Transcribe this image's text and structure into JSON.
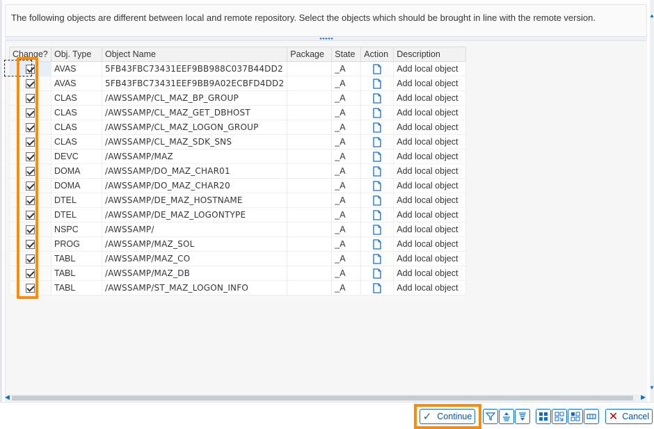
{
  "message": "The following objects are different between local and remote repository. Select the objects which should be brought in line with the remote version.",
  "columns": {
    "change": "Change?",
    "obj_type": "Obj. Type",
    "object_name": "Object Name",
    "package": "Package",
    "state": "State",
    "action": "Action",
    "description": "Description"
  },
  "action_icon": "document-icon",
  "rows": [
    {
      "checked": true,
      "type": "AVAS",
      "name": "5FB43FBC73431EEF9BB988C037B44DD2",
      "package": "",
      "state": "_A",
      "description": "Add local object"
    },
    {
      "checked": true,
      "type": "AVAS",
      "name": "5FB43FBC73431EEF9BB9A02ECBFD4DD2",
      "package": "",
      "state": "_A",
      "description": "Add local object"
    },
    {
      "checked": true,
      "type": "CLAS",
      "name": "/AWSSAMP/CL_MAZ_BP_GROUP",
      "package": "",
      "state": "_A",
      "description": "Add local object"
    },
    {
      "checked": true,
      "type": "CLAS",
      "name": "/AWSSAMP/CL_MAZ_GET_DBHOST",
      "package": "",
      "state": "_A",
      "description": "Add local object"
    },
    {
      "checked": true,
      "type": "CLAS",
      "name": "/AWSSAMP/CL_MAZ_LOGON_GROUP",
      "package": "",
      "state": "_A",
      "description": "Add local object"
    },
    {
      "checked": true,
      "type": "CLAS",
      "name": "/AWSSAMP/CL_MAZ_SDK_SNS",
      "package": "",
      "state": "_A",
      "description": "Add local object"
    },
    {
      "checked": true,
      "type": "DEVC",
      "name": "/AWSSAMP/MAZ",
      "package": "",
      "state": "_A",
      "description": "Add local object"
    },
    {
      "checked": true,
      "type": "DOMA",
      "name": "/AWSSAMP/DO_MAZ_CHAR01",
      "package": "",
      "state": "_A",
      "description": "Add local object"
    },
    {
      "checked": true,
      "type": "DOMA",
      "name": "/AWSSAMP/DO_MAZ_CHAR20",
      "package": "",
      "state": "_A",
      "description": "Add local object"
    },
    {
      "checked": true,
      "type": "DTEL",
      "name": "/AWSSAMP/DE_MAZ_HOSTNAME",
      "package": "",
      "state": "_A",
      "description": "Add local object"
    },
    {
      "checked": true,
      "type": "DTEL",
      "name": "/AWSSAMP/DE_MAZ_LOGONTYPE",
      "package": "",
      "state": "_A",
      "description": "Add local object"
    },
    {
      "checked": true,
      "type": "NSPC",
      "name": "/AWSSAMP/",
      "package": "",
      "state": "_A",
      "description": "Add local object"
    },
    {
      "checked": true,
      "type": "PROG",
      "name": "/AWSSAMP/MAZ_SOL",
      "package": "",
      "state": "_A",
      "description": "Add local object"
    },
    {
      "checked": true,
      "type": "TABL",
      "name": "/AWSSAMP/MAZ_CO",
      "package": "",
      "state": "_A",
      "description": "Add local object"
    },
    {
      "checked": true,
      "type": "TABL",
      "name": "/AWSSAMP/MAZ_DB",
      "package": "",
      "state": "_A",
      "description": "Add local object"
    },
    {
      "checked": true,
      "type": "TABL",
      "name": "/AWSSAMP/ST_MAZ_LOGON_INFO",
      "package": "",
      "state": "_A",
      "description": "Add local object"
    }
  ],
  "footer": {
    "continue_label": "Continue",
    "cancel_label": "Cancel",
    "continue_icon": "checkmark-icon",
    "cancel_icon": "x-icon",
    "tool_icons": [
      "filter-icon",
      "sort-ascending-icon",
      "sort-descending-icon",
      "select-all-icon",
      "select-block-icon",
      "deselect-all-icon",
      "details-icon"
    ]
  },
  "colors": {
    "highlight": "#ff8c00",
    "accent": "#0a6ed1",
    "continue_check": "#107e3e",
    "cancel_x": "#bb0000"
  }
}
